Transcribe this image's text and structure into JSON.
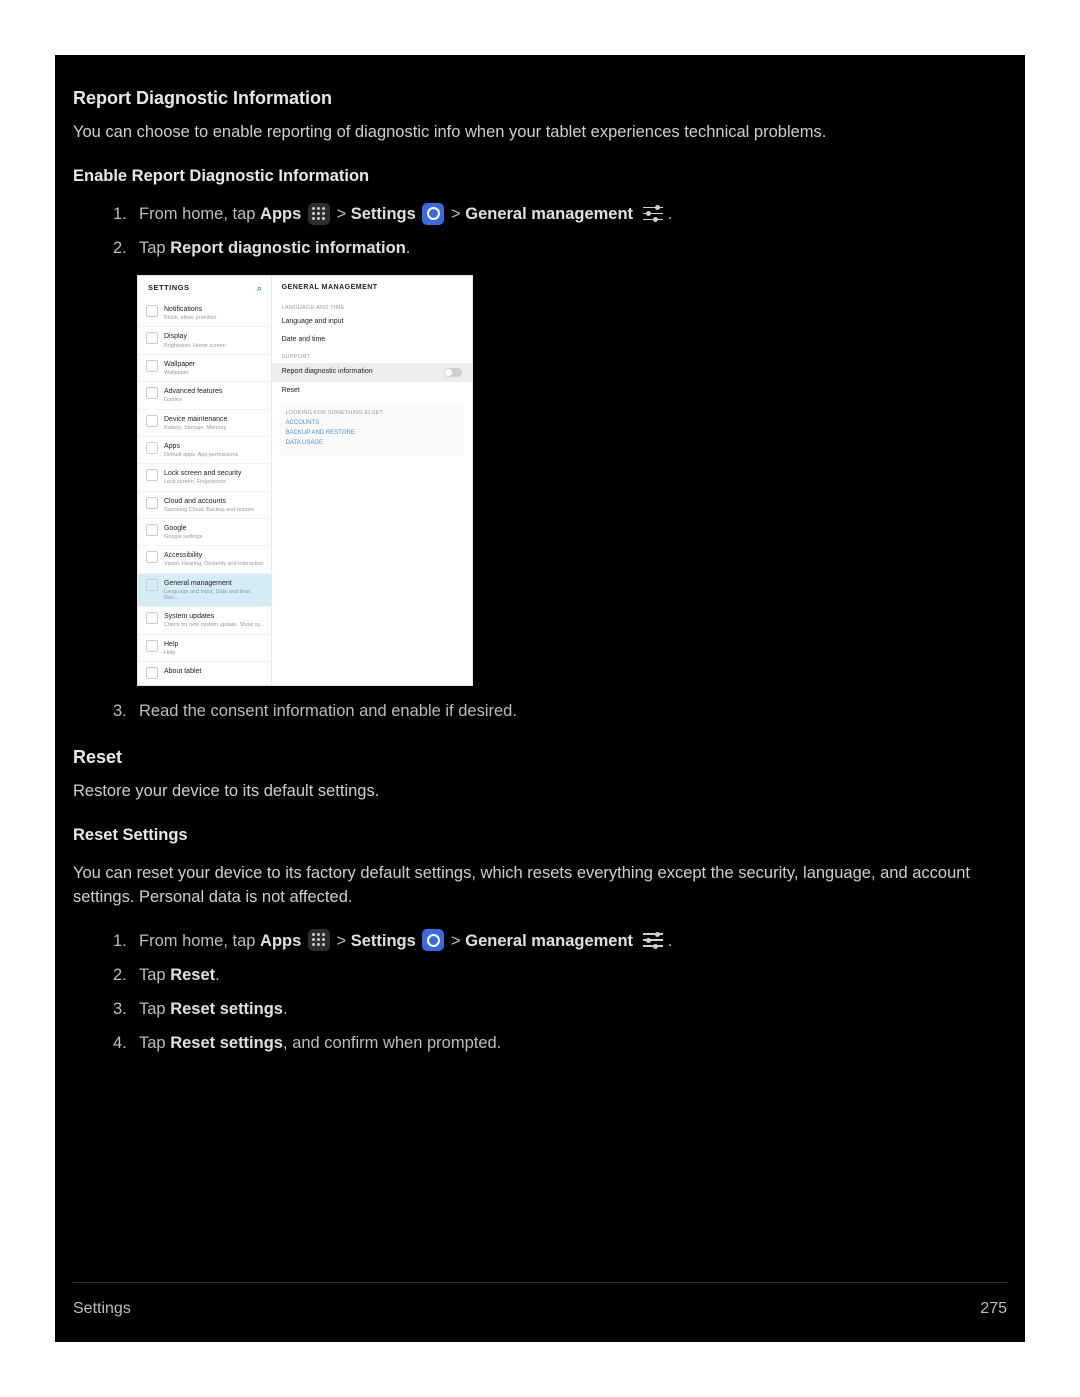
{
  "section1_title": "Report Diagnostic Information",
  "intro1": "You can choose to enable reporting of diagnostic info when your tablet experiences technical problems.",
  "subtitle1": "Enable Report Diagnostic Information",
  "steps1": [
    {
      "num": "1.",
      "pref": "From home, tap ",
      "b1": "Apps",
      "sep1": " > ",
      "b2": "Settings",
      "sep2": " > ",
      "b3": "General management",
      "suf": "."
    },
    {
      "num": "2.",
      "text": "Tap ",
      "b": "Report diagnostic information",
      "suf": "."
    },
    {
      "num": "3.",
      "text": "Read the consent information and enable if desired."
    }
  ],
  "section2_title": "Reset",
  "intro2": "Restore your device to its default settings.",
  "subtitle2": "Reset Settings",
  "intro3": "You can reset your device to its factory default settings, which resets everything except the security, language, and account settings. Personal data is not affected.",
  "steps2": [
    {
      "num": "1.",
      "pref": "From home, tap ",
      "b1": "Apps",
      "sep1": " > ",
      "b2": "Settings",
      "sep2": " > ",
      "b3": "General management",
      "suf": "."
    },
    {
      "num": "2.",
      "text": "Tap ",
      "b": "Reset",
      "suf": "."
    },
    {
      "num": "3.",
      "text": "Tap ",
      "b": "Reset settings",
      "suf": "."
    },
    {
      "num": "4.",
      "text": "Tap ",
      "b": "Reset settings",
      "suf": ", and confirm when prompted."
    }
  ],
  "screenshot": {
    "left_header": "SETTINGS",
    "items": [
      {
        "label": "Notifications",
        "sub": "Block, allow, prioritize",
        "color": "c-teal"
      },
      {
        "label": "Display",
        "sub": "Brightness, Home screen",
        "color": "c-orange"
      },
      {
        "label": "Wallpaper",
        "sub": "Wallpaper",
        "color": "c-purple"
      },
      {
        "label": "Advanced features",
        "sub": "Games",
        "color": "c-yellow"
      },
      {
        "label": "Device maintenance",
        "sub": "Battery, Storage, Memory",
        "color": "c-teal"
      },
      {
        "label": "Apps",
        "sub": "Default apps, App permissions",
        "color": "c-blue"
      },
      {
        "label": "Lock screen and security",
        "sub": "Lock screen, Fingerprints",
        "color": "c-pink"
      },
      {
        "label": "Cloud and accounts",
        "sub": "Samsung Cloud, Backup and restore",
        "color": "c-grey"
      },
      {
        "label": "Google",
        "sub": "Google settings",
        "color": "c-grey"
      },
      {
        "label": "Accessibility",
        "sub": "Vision, Hearing, Dexterity and interaction",
        "color": "c-blue"
      },
      {
        "label": "General management",
        "sub": "Language and input, Date and time, Res...",
        "color": "c-green",
        "selected": true
      },
      {
        "label": "System updates",
        "sub": "Check for new system update, Show sy...",
        "color": "c-red"
      },
      {
        "label": "Help",
        "sub": "Help",
        "color": "c-grey"
      },
      {
        "label": "About tablet",
        "sub": "",
        "color": "c-grey"
      }
    ],
    "right_header": "GENERAL MANAGEMENT",
    "cat1": "LANGUAGE AND TIME",
    "r1": "Language and input",
    "r2": "Date and time",
    "cat2": "SUPPORT",
    "r3": "Report diagnostic information",
    "r4": "Reset",
    "box_title": "LOOKING FOR SOMETHING ELSE?",
    "link1": "ACCOUNTS",
    "link2": "BACKUP AND RESTORE",
    "link3": "DATA USAGE"
  },
  "footer_left": "Settings",
  "footer_right": "275"
}
